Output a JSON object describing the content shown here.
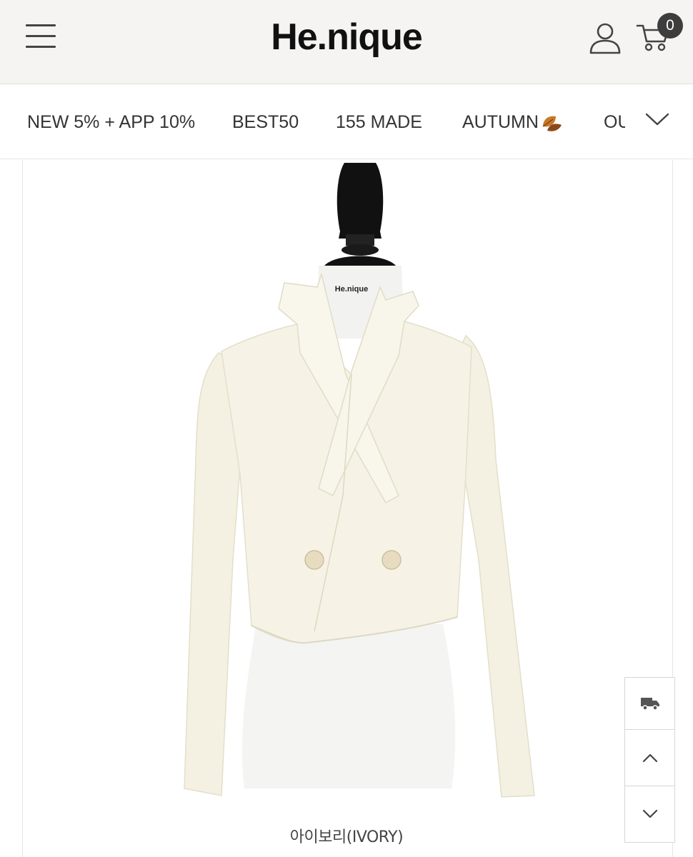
{
  "header": {
    "logo": "He.nique",
    "cart_count": "0"
  },
  "nav": {
    "categories": [
      "NEW 5% + APP 10%",
      "BEST50",
      "155 MADE",
      "AUTUMN",
      "OU"
    ]
  },
  "product": {
    "mannequin_tag": "He.nique",
    "color_caption": "아이보리(IVORY)"
  },
  "icons": {
    "menu": "hamburger-icon",
    "user": "user-icon",
    "cart": "cart-icon",
    "autumn": "leaf-icon",
    "expand": "chevron-down-icon",
    "delivery": "truck-icon",
    "scroll_up": "chevron-up-icon",
    "scroll_down": "chevron-down-icon"
  },
  "colors": {
    "header_bg": "#f5f4f2",
    "text": "#333333",
    "badge": "#3d3d3d",
    "jacket": "#f6f3e6"
  }
}
